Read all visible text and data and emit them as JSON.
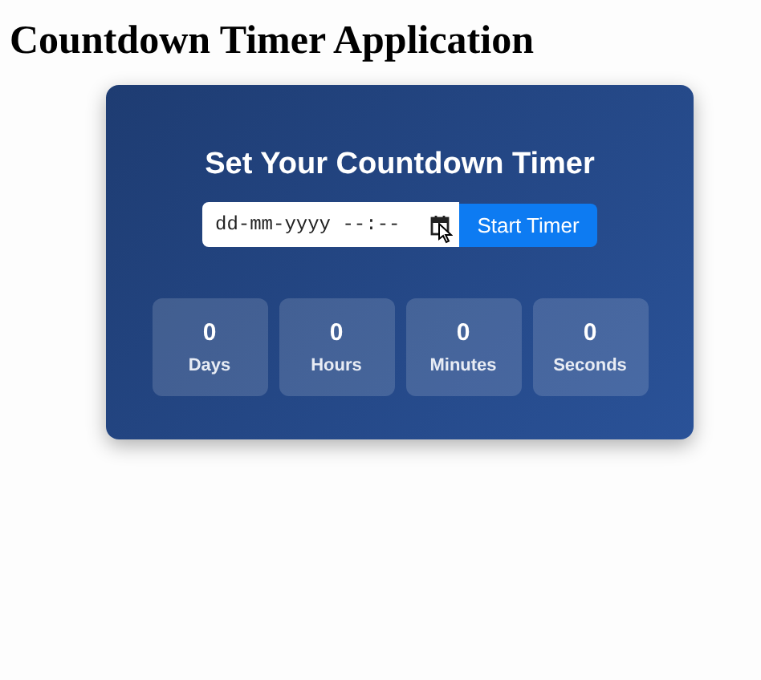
{
  "page_title": "Countdown Timer Application",
  "card": {
    "title": "Set Your Countdown Timer",
    "date_field": {
      "placeholder": "dd-mm-yyyy --:--"
    },
    "start_button": "Start Timer",
    "units": [
      {
        "value": "0",
        "label": "Days"
      },
      {
        "value": "0",
        "label": "Hours"
      },
      {
        "value": "0",
        "label": "Minutes"
      },
      {
        "value": "0",
        "label": "Seconds"
      }
    ]
  }
}
